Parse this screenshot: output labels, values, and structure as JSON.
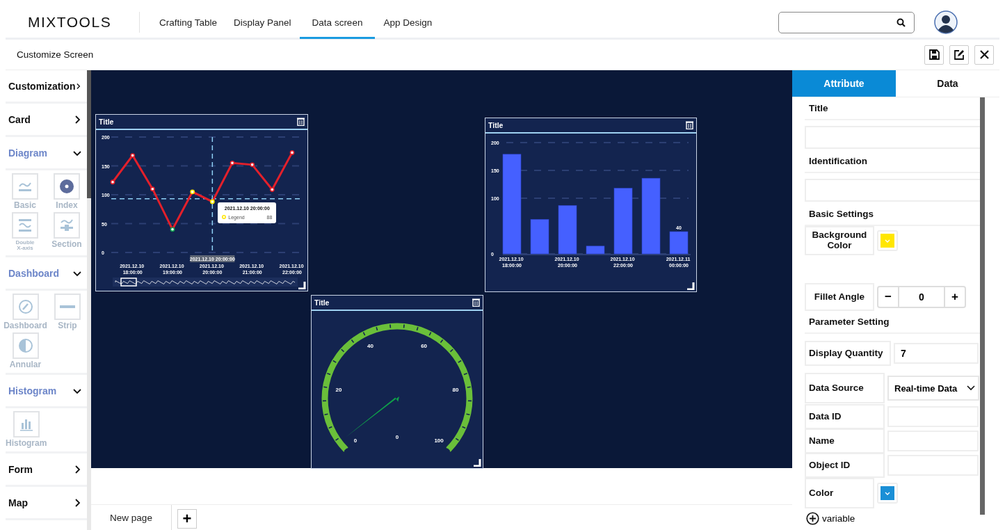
{
  "app": {
    "logo": "MIXTOOLS"
  },
  "nav_tabs": [
    {
      "label": "Crafting Table",
      "selected": false
    },
    {
      "label": "Display Panel",
      "selected": false
    },
    {
      "label": "Data screen",
      "selected": true
    },
    {
      "label": "App Design",
      "selected": false
    }
  ],
  "toolbar": {
    "title": "Customize Screen"
  },
  "sidebar": [
    {
      "label": "Customization",
      "expanded": false
    },
    {
      "label": "Card",
      "expanded": false
    },
    {
      "label": "Diagram",
      "expanded": true,
      "children": [
        {
          "label": "Basic"
        },
        {
          "label": "Index"
        },
        {
          "label": "Double X-axis"
        },
        {
          "label": "Section"
        }
      ]
    },
    {
      "label": "Dashboard",
      "expanded": true,
      "children": [
        {
          "label": "Dashboard"
        },
        {
          "label": "Strip"
        },
        {
          "label": "Annular"
        }
      ]
    },
    {
      "label": "Histogram",
      "expanded": true,
      "children": [
        {
          "label": "Histogram"
        }
      ]
    },
    {
      "label": "Form",
      "expanded": false
    },
    {
      "label": "Map",
      "expanded": false
    }
  ],
  "line_card": {
    "title": "Title",
    "chart_data": {
      "type": "line",
      "categories": [
        null,
        "2021.12.10 18:00:00",
        null,
        "2021.12.10 19:00:00",
        null,
        "2021.12.10 20:00:00",
        null,
        "2021.12.10 21:00:00",
        null,
        "2021.12.10 22:00:00"
      ],
      "series": [
        {
          "name": "Legend",
          "color": "#e3202b",
          "marker": "circle",
          "values": [
            122,
            168,
            110,
            40,
            105,
            88,
            155,
            152,
            109,
            173
          ]
        }
      ],
      "ylim": [
        0,
        200
      ],
      "yticks": [
        0,
        50,
        100,
        150,
        200
      ],
      "grid": true,
      "ref_lines": [
        {
          "axis": "x",
          "value": "2021.12.10 20:00:00"
        },
        {
          "axis": "y",
          "value": 93
        }
      ]
    },
    "axis_pointer_label": "2021.12.10 20:00:00",
    "tooltip": {
      "title": "2021.12.10 20:00:00",
      "value": "88"
    }
  },
  "bar_card": {
    "title": "Title",
    "chart_data": {
      "type": "bar",
      "categories": [
        "2021.12.10 18:00:00",
        null,
        "2021.12.10 20:00:00",
        null,
        "2021.12.10 22:00:00",
        null,
        "2021.12.11 00:00:00"
      ],
      "series": [
        {
          "color": "#4560ff",
          "values": [
            179,
            62,
            87,
            14,
            118,
            136,
            40
          ]
        }
      ],
      "ylim": [
        0,
        200
      ],
      "yticks": [
        0,
        100,
        150,
        200
      ],
      "grid": true,
      "annotations": [
        {
          "x": "2021.12.11 00:00:00",
          "y": 40,
          "text": "40"
        }
      ]
    }
  },
  "gauge_card": {
    "title": "Title",
    "scale_labels": [
      "0",
      "20",
      "40",
      "60",
      "80",
      "100"
    ],
    "value": "0"
  },
  "pages": [
    {
      "label": "New page",
      "selected": true
    }
  ],
  "add_page": "+",
  "panel_tabs": [
    {
      "label": "Attribute",
      "selected": true
    },
    {
      "label": "Data",
      "selected": false
    }
  ],
  "form": [
    {
      "kind": "heading",
      "label": "Title"
    },
    {
      "kind": "input"
    },
    {
      "kind": "heading",
      "label": "Identification"
    },
    {
      "kind": "input"
    },
    {
      "kind": "heading",
      "label": "Basic Settings"
    },
    {
      "kind": "color",
      "label": "Background Color",
      "color": "#ffe600"
    },
    {
      "kind": "stepper",
      "label": "Fillet Angle",
      "minus": "−",
      "value": "0",
      "plus": "+"
    },
    {
      "kind": "heading",
      "label": "Parameter Setting"
    },
    {
      "kind": "field",
      "label": "Display Quantity",
      "value": "7"
    },
    {
      "kind": "select",
      "label": "Data Source",
      "value": "Real-time Data"
    },
    {
      "kind": "field",
      "label": "Data ID"
    },
    {
      "kind": "field",
      "label": "Name"
    },
    {
      "kind": "field",
      "label": "Object ID"
    },
    {
      "kind": "color",
      "label": "Color",
      "color": "#1a8fd6"
    }
  ],
  "add_variable": "variable"
}
